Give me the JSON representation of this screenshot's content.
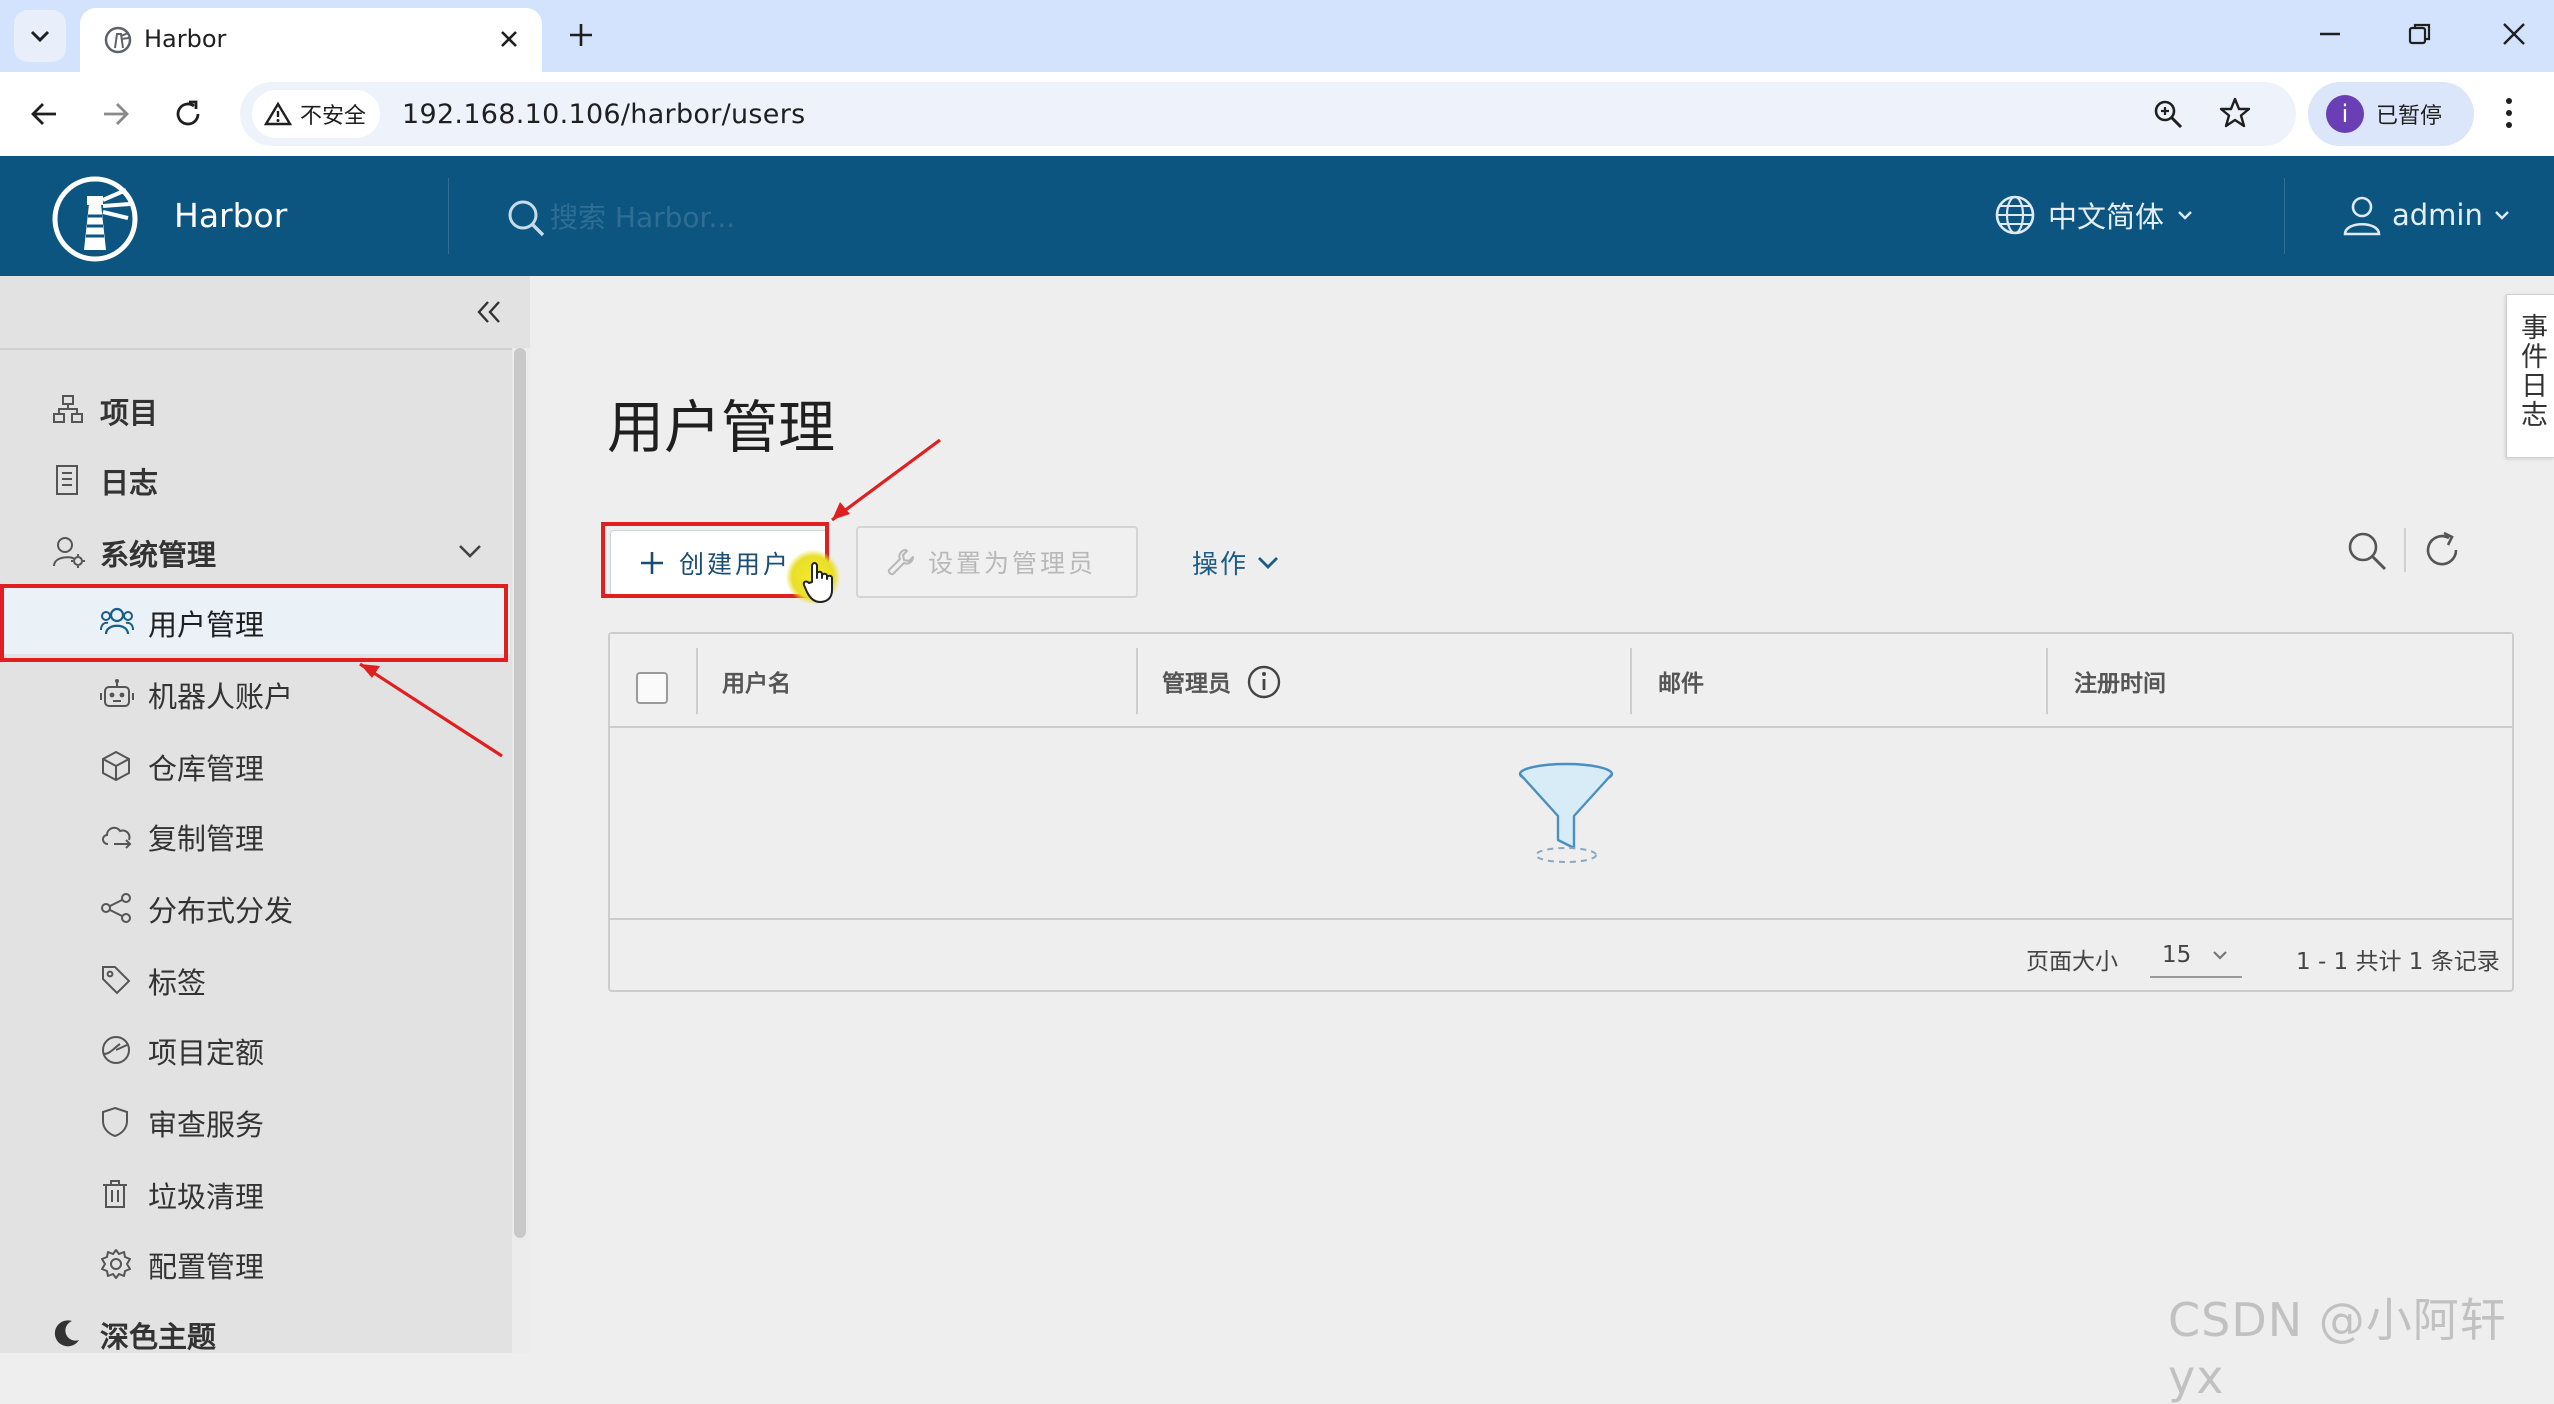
{
  "browser": {
    "tab_title": "Harbor",
    "security_label": "不安全",
    "url": "192.168.10.106/harbor/users",
    "profile_initial": "i",
    "profile_label": "已暂停"
  },
  "header": {
    "brand": "Harbor",
    "search_placeholder": "搜索 Harbor...",
    "language": "中文简体",
    "user": "admin"
  },
  "sidebar": {
    "items": [
      {
        "label": "项目",
        "icon": "projects-icon"
      },
      {
        "label": "日志",
        "icon": "logs-icon"
      },
      {
        "label": "系统管理",
        "icon": "admin-icon",
        "expanded": true
      }
    ],
    "sub_items": [
      {
        "label": "用户管理",
        "icon": "users-icon",
        "active": true
      },
      {
        "label": "机器人账户",
        "icon": "robot-icon"
      },
      {
        "label": "仓库管理",
        "icon": "registry-icon"
      },
      {
        "label": "复制管理",
        "icon": "replication-icon"
      },
      {
        "label": "分布式分发",
        "icon": "distribution-icon"
      },
      {
        "label": "标签",
        "icon": "tag-icon"
      },
      {
        "label": "项目定额",
        "icon": "quota-icon"
      },
      {
        "label": "审查服务",
        "icon": "shield-icon"
      },
      {
        "label": "垃圾清理",
        "icon": "trash-icon"
      },
      {
        "label": "配置管理",
        "icon": "gear-icon"
      }
    ],
    "theme_toggle": "深色主题"
  },
  "main": {
    "page_title": "用户管理",
    "toolbar": {
      "create_user": "创建用户",
      "set_admin": "设置为管理员",
      "action": "操作"
    },
    "table": {
      "columns": [
        "用户名",
        "管理员",
        "邮件",
        "注册时间"
      ],
      "rows": []
    },
    "footer": {
      "page_size_label": "页面大小",
      "page_size": "15",
      "summary": "1 - 1 共计 1 条记录"
    }
  },
  "event_log_tab": "事件日志",
  "watermark": "CSDN @小阿轩yx",
  "colors": {
    "header_bg": "#0c5580",
    "sidebar_bg": "#e2e2e2",
    "annotation_red": "#e02020",
    "link_blue": "#1a5c8a"
  }
}
